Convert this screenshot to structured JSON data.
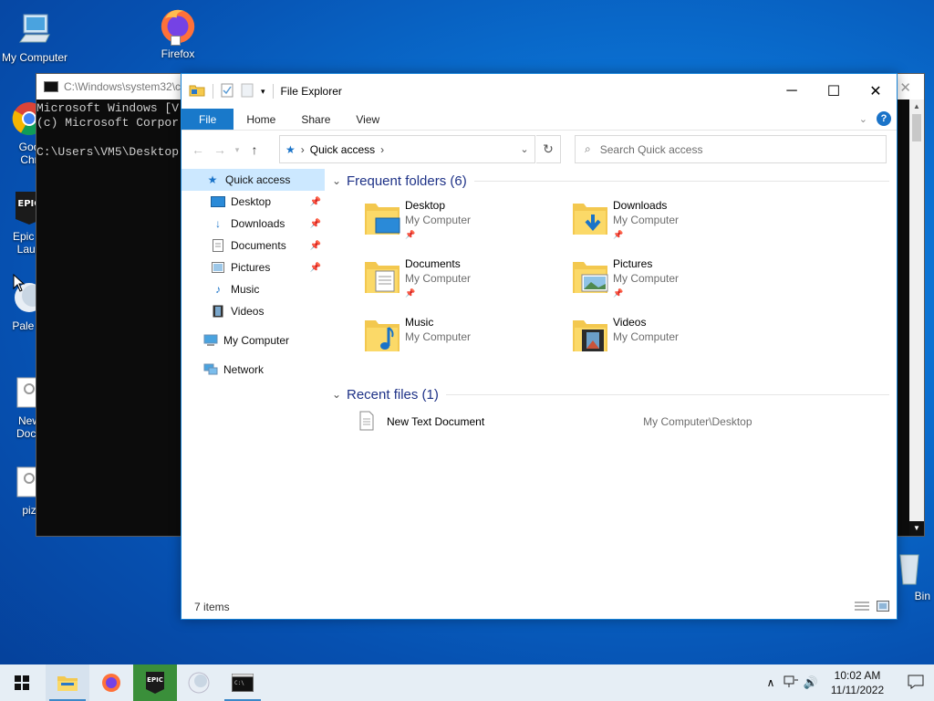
{
  "desktop": {
    "icons": [
      {
        "label": "My Computer"
      },
      {
        "label": "Firefox"
      },
      {
        "label": "Goo Chr"
      },
      {
        "label": "Epic G Laun"
      },
      {
        "label": "Pale M"
      },
      {
        "label": "New Docu"
      },
      {
        "label": "piz"
      },
      {
        "label": "Bin"
      }
    ]
  },
  "cmd": {
    "title": "C:\\Windows\\system32\\c",
    "lines": [
      "Microsoft Windows [V",
      "(c) Microsoft Corpor",
      "",
      "C:\\Users\\VM5\\Desktop"
    ]
  },
  "explorer": {
    "title": "File Explorer",
    "ribbon": {
      "file": "File",
      "home": "Home",
      "share": "Share",
      "view": "View",
      "help": "?"
    },
    "address": {
      "location": "Quick access"
    },
    "search": {
      "placeholder": "Search Quick access"
    },
    "nav": {
      "quick_access": "Quick access",
      "desktop": "Desktop",
      "downloads": "Downloads",
      "documents": "Documents",
      "pictures": "Pictures",
      "music": "Music",
      "videos": "Videos",
      "my_computer": "My Computer",
      "network": "Network"
    },
    "frequent": {
      "header": "Frequent folders (6)",
      "items": [
        {
          "name": "Desktop",
          "location": "My Computer"
        },
        {
          "name": "Downloads",
          "location": "My Computer"
        },
        {
          "name": "Documents",
          "location": "My Computer"
        },
        {
          "name": "Pictures",
          "location": "My Computer"
        },
        {
          "name": "Music",
          "location": "My Computer"
        },
        {
          "name": "Videos",
          "location": "My Computer"
        }
      ]
    },
    "recent": {
      "header": "Recent files (1)",
      "items": [
        {
          "name": "New Text Document",
          "path": "My Computer\\Desktop"
        }
      ]
    },
    "status": "7 items"
  },
  "taskbar": {
    "time": "10:02 AM",
    "date": "11/11/2022"
  }
}
